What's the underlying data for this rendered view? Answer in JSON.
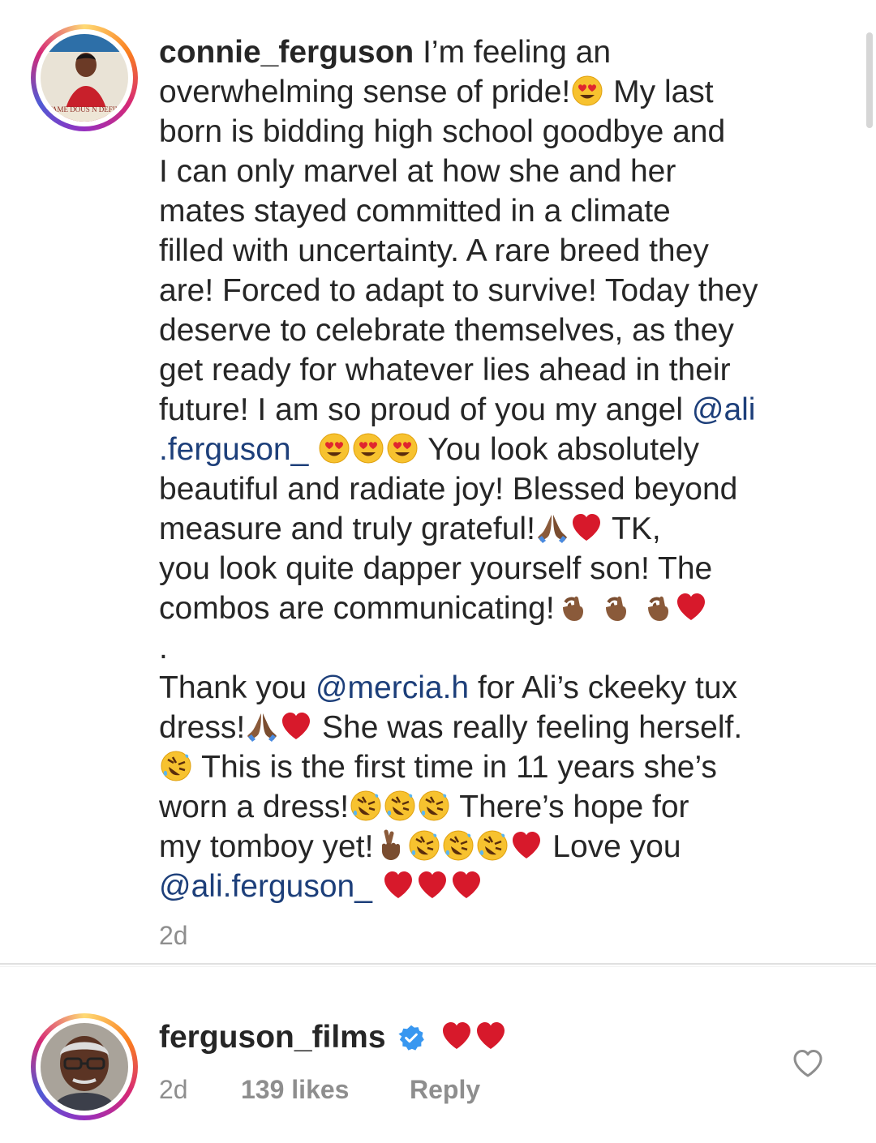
{
  "post": {
    "username": "connie_ferguson",
    "lines": [
      "I’m feeling an",
      "overwhelming sense of pride!",
      "My last",
      "born is bidding high school goodbye and",
      "I can only marvel at how she and her",
      "mates stayed committed in a climate",
      "filled with uncertainty. A rare breed they",
      "are! Forced to adapt to survive! Today they",
      "deserve to celebrate themselves, as they",
      "get ready for whatever lies ahead in their",
      "future! I am so proud of you my angel",
      "You look absolutely",
      "beautiful and radiate joy! Blessed beyond",
      "measure and truly grateful!",
      "TK,",
      "you look quite dapper yourself son! The",
      "combos are communicating!",
      ".",
      "Thank you",
      "for Ali’s ckeeky tux",
      "dress!",
      "She was really feeling herself.",
      "This is the first time in 11 years she’s",
      "worn a dress!",
      "There’s hope for",
      "my tomboy yet!",
      "Love you"
    ],
    "mention_ali_part1": "@ali",
    "mention_ali_part2": ".ferguson_",
    "mention_mercia": "@mercia.h",
    "mention_ali_full": "@ali.ferguson_",
    "time": "2d",
    "avatar_cover_text": "FAME DOUS N DEFIN"
  },
  "comment": {
    "username": "ferguson_films",
    "verified_icon": "verified-badge-icon",
    "time": "2d",
    "likes": "139 likes",
    "reply_label": "Reply",
    "like_icon": "heart-outline-icon"
  },
  "colors": {
    "mention": "#1d3f7a",
    "muted": "#8e8e8e",
    "verified": "#3897f0",
    "heart": "#d7192b"
  }
}
